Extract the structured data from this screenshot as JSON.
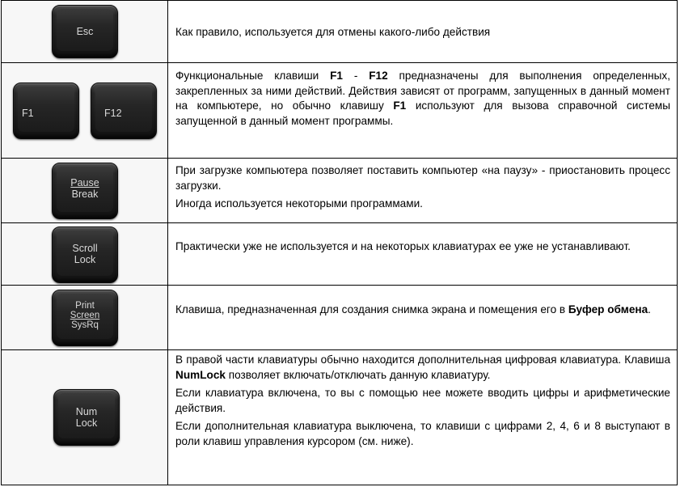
{
  "rows": [
    {
      "key_labels": [
        "Esc"
      ],
      "paragraphs": [
        [
          {
            "t": "Как правило, используется для отмены какого-либо действия"
          }
        ]
      ]
    },
    {
      "key_labels": [
        "F1",
        "F12"
      ],
      "paragraphs": [
        [
          {
            "t": "Функциональные клавиши "
          },
          {
            "t": "F1",
            "b": true
          },
          {
            "t": " - "
          },
          {
            "t": "F12",
            "b": true
          },
          {
            "t": " предназначены для выполнения определенных, закрепленных за ними действий. Действия зависят от программ, запущенных в данный момент на компьютере, но обычно клавишу "
          },
          {
            "t": "F1",
            "b": true
          },
          {
            "t": " используют для вызова справочной системы запущенной в данный момент программы."
          }
        ]
      ]
    },
    {
      "key_labels": [
        "Pause",
        "Break"
      ],
      "paragraphs": [
        [
          {
            "t": "При загрузке компьютера позволяет поставить компьютер «на паузу» - приостановить процесс загрузки."
          }
        ],
        [
          {
            "t": "Иногда используется некоторыми программами."
          }
        ]
      ]
    },
    {
      "key_labels": [
        "Scroll",
        "Lock"
      ],
      "paragraphs": [
        [
          {
            "t": "Практически уже не используется и на некоторых клавиатурах ее уже не устанавливают."
          }
        ]
      ]
    },
    {
      "key_labels": [
        "Print",
        "Screen",
        "SysRq"
      ],
      "paragraphs": [
        [
          {
            "t": "Клавиша, предназначенная для создания снимка экрана и помещения его в "
          },
          {
            "t": "Буфер обмена",
            "b": true
          },
          {
            "t": "."
          }
        ]
      ]
    },
    {
      "key_labels": [
        "Num",
        "Lock"
      ],
      "paragraphs": [
        [
          {
            "t": "В правой части клавиатуры обычно находится дополнительная цифровая клавиатура. Клавиша "
          },
          {
            "t": "NumLock",
            "b": true
          },
          {
            "t": " позволяет включать/отключать данную клавиатуру."
          }
        ],
        [
          {
            "t": "Если клавиатура включена, то вы с помощью нее можете вводить цифры и арифметические действия."
          }
        ],
        [
          {
            "t": "Если дополнительная клавиатура выключена, то клавиши с цифрами 2, 4, 6 и 8 выступают в роли клавиш управления курсором (см. ниже)."
          }
        ]
      ]
    }
  ]
}
